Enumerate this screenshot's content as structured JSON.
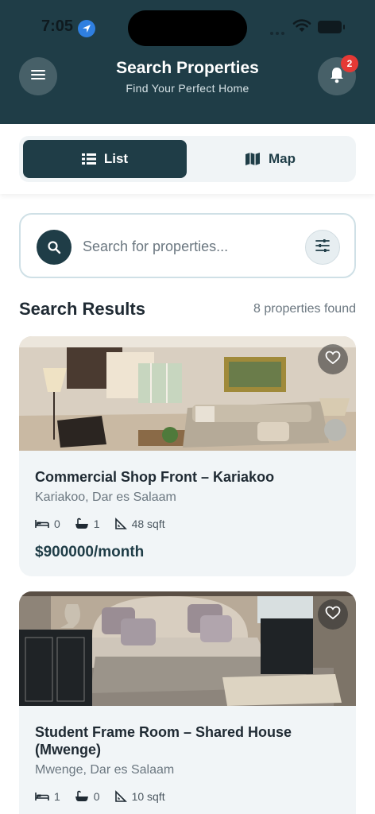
{
  "status": {
    "time": "7:05"
  },
  "header": {
    "title": "Search Properties",
    "subtitle": "Find Your Perfect Home",
    "notification_count": "2"
  },
  "view_toggle": {
    "list_label": "List",
    "map_label": "Map",
    "selected": "List"
  },
  "search": {
    "placeholder": "Search for properties..."
  },
  "results": {
    "title": "Search Results",
    "count_text": "8 properties found"
  },
  "listings": [
    {
      "title": "Commercial Shop Front – Kariakoo",
      "location": "Kariakoo, Dar es Salaam",
      "beds": "0",
      "baths": "1",
      "area": "48 sqft",
      "price": "$900000/month"
    },
    {
      "title": "Student Frame Room – Shared House (Mwenge)",
      "location": "Mwenge, Dar es Salaam",
      "beds": "1",
      "baths": "0",
      "area": "10 sqft"
    }
  ],
  "colors": {
    "primary": "#1f3d47",
    "badge": "#e53935",
    "card_bg": "#f1f5f7"
  },
  "icons": [
    "menu-icon",
    "bell-icon",
    "list-icon",
    "map-icon",
    "search-icon",
    "filter-icon",
    "heart-icon",
    "bed-icon",
    "bath-icon",
    "area-icon"
  ]
}
